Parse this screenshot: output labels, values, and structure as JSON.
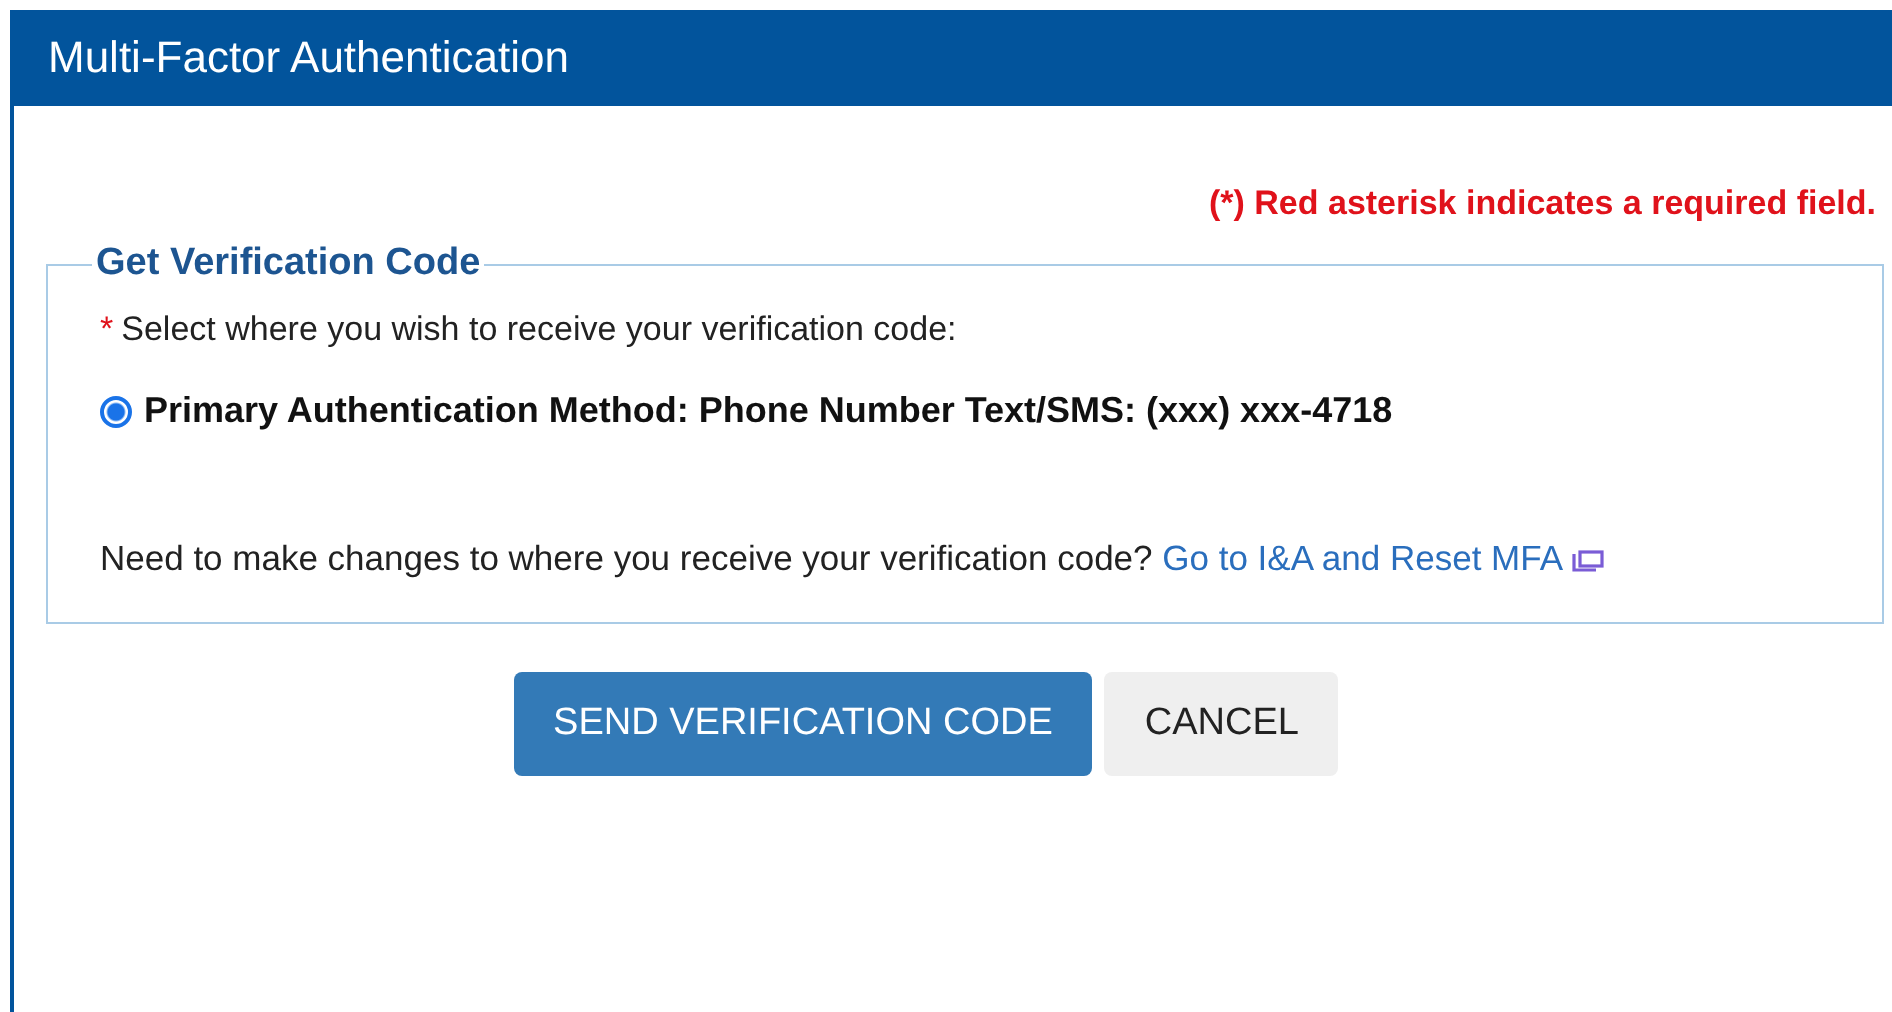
{
  "window": {
    "title": "Multi-Factor Authentication"
  },
  "required_note": "(*) Red asterisk indicates a required field.",
  "section": {
    "title": "Get Verification Code",
    "prompt": {
      "asterisk": "*",
      "text": "Select where you wish to receive your verification code:"
    },
    "options": [
      {
        "label": "Primary Authentication Method: Phone Number Text/SMS: (xxx) xxx-4718",
        "selected": true
      }
    ],
    "help": {
      "text": "Need to make changes to where you receive your verification code?",
      "link": "Go to I&A and Reset MFA"
    }
  },
  "buttons": [
    {
      "label": "SEND VERIFICATION CODE",
      "kind": "primary"
    },
    {
      "label": "CANCEL",
      "kind": "secondary"
    }
  ]
}
